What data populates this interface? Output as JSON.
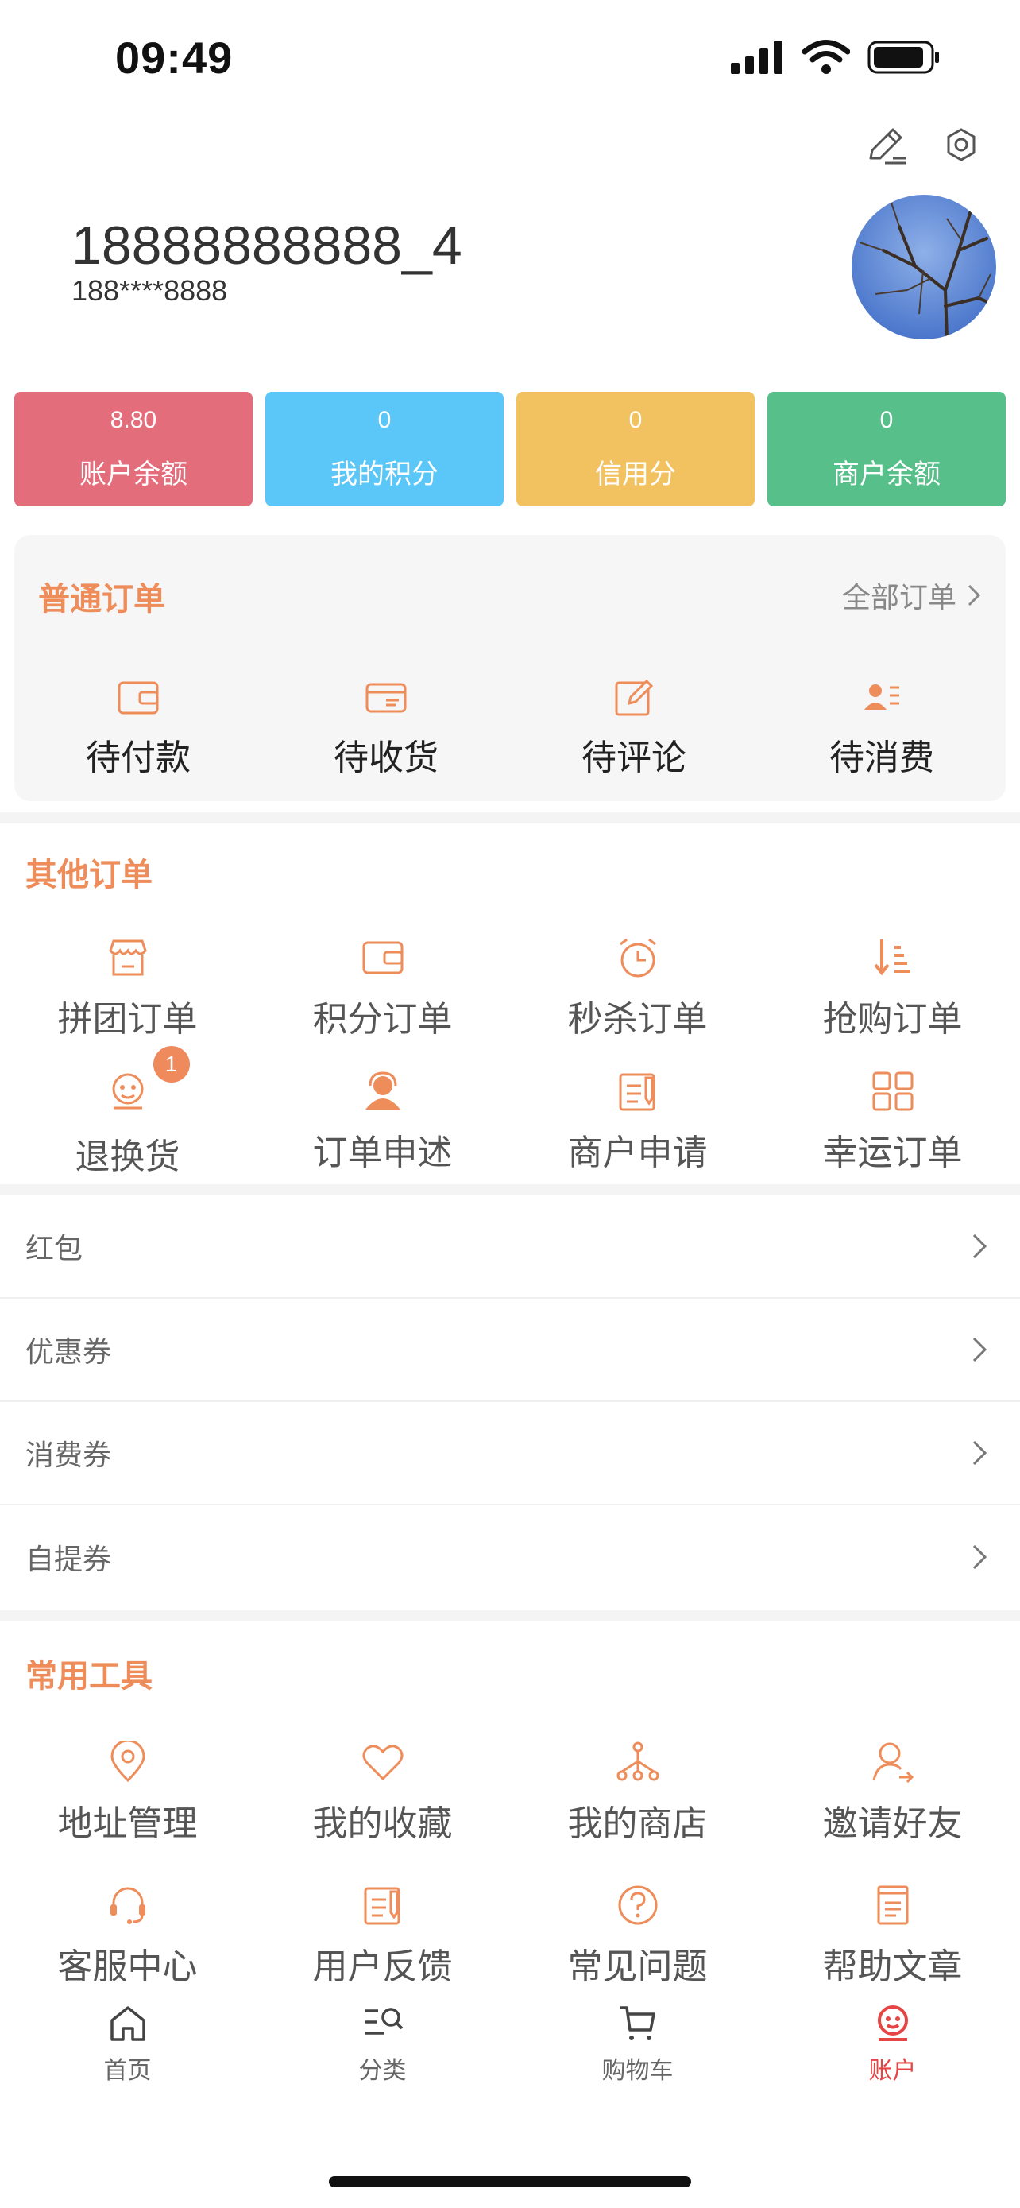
{
  "status": {
    "time": "09:49"
  },
  "profile": {
    "username": "18888888888_4",
    "phone": "188****8888"
  },
  "stats": [
    {
      "value": "8.80",
      "label": "账户余额",
      "color": "#e46d7c"
    },
    {
      "value": "0",
      "label": "我的积分",
      "color": "#5bc7f8"
    },
    {
      "value": "0",
      "label": "信用分",
      "color": "#f3c260"
    },
    {
      "value": "0",
      "label": "商户余额",
      "color": "#56bf8a"
    }
  ],
  "regular_orders": {
    "title": "普通订单",
    "all_link": "全部订单",
    "items": [
      {
        "label": "待付款",
        "icon": "wallet-icon"
      },
      {
        "label": "待收货",
        "icon": "card-icon"
      },
      {
        "label": "待评论",
        "icon": "edit-icon"
      },
      {
        "label": "待消费",
        "icon": "user-list-icon"
      }
    ]
  },
  "other_orders": {
    "title": "其他订单",
    "items": [
      {
        "label": "拼团订单",
        "icon": "store-icon"
      },
      {
        "label": "积分订单",
        "icon": "wallet-icon"
      },
      {
        "label": "秒杀订单",
        "icon": "alarm-clock-icon"
      },
      {
        "label": "抢购订单",
        "icon": "sort-desc-icon"
      },
      {
        "label": "退换货",
        "icon": "return-face-icon",
        "badge": "1"
      },
      {
        "label": "订单申述",
        "icon": "support-agent-icon"
      },
      {
        "label": "商户申请",
        "icon": "form-icon"
      },
      {
        "label": "幸运订单",
        "icon": "grid-icon"
      }
    ]
  },
  "list_items": [
    {
      "label": "红包"
    },
    {
      "label": "优惠券"
    },
    {
      "label": "消费券"
    },
    {
      "label": "自提券"
    }
  ],
  "tools": {
    "title": "常用工具",
    "items": [
      {
        "label": "地址管理",
        "icon": "location-pin-icon"
      },
      {
        "label": "我的收藏",
        "icon": "heart-icon"
      },
      {
        "label": "我的商店",
        "icon": "network-icon"
      },
      {
        "label": "邀请好友",
        "icon": "invite-user-icon"
      },
      {
        "label": "客服中心",
        "icon": "headset-icon"
      },
      {
        "label": "用户反馈",
        "icon": "feedback-icon"
      },
      {
        "label": "常见问题",
        "icon": "question-icon"
      },
      {
        "label": "帮助文章",
        "icon": "document-icon"
      }
    ]
  },
  "tabbar": [
    {
      "label": "首页",
      "icon": "home-icon"
    },
    {
      "label": "分类",
      "icon": "category-search-icon"
    },
    {
      "label": "购物车",
      "icon": "cart-icon"
    },
    {
      "label": "账户",
      "icon": "account-icon",
      "active": true
    }
  ],
  "colors": {
    "accent": "#ee8c5a",
    "active_tab": "#e64545"
  }
}
